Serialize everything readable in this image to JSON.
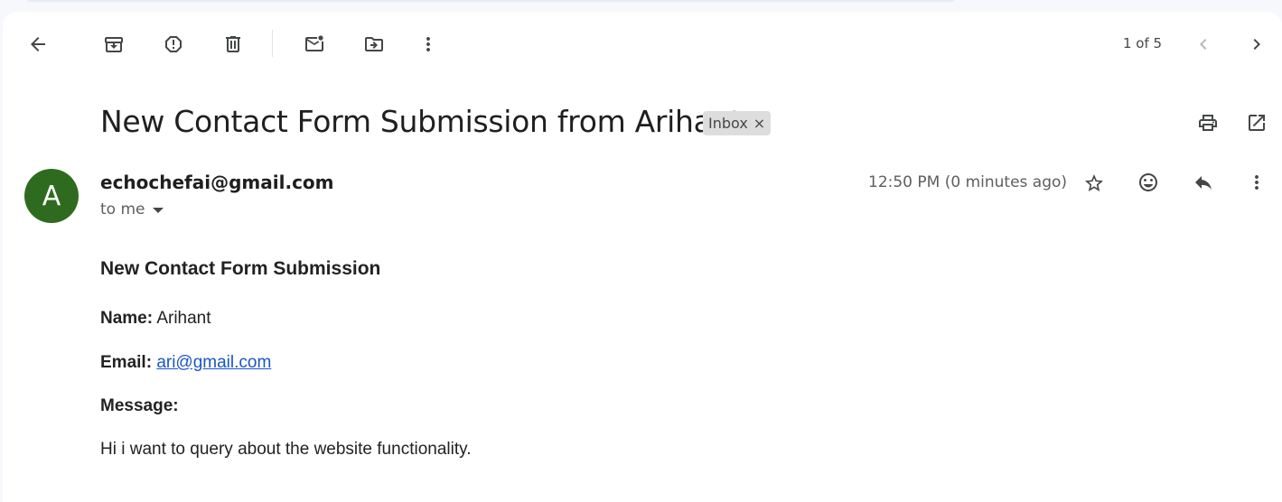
{
  "toolbar": {
    "icons": [
      "back-arrow-icon",
      "archive-icon",
      "report-spam-icon",
      "delete-icon",
      "mark-unread-icon",
      "move-to-icon",
      "more-vert-icon"
    ],
    "pager_text": "1 of 5"
  },
  "email": {
    "subject": "New Contact Form Submission from Arihant",
    "label": "Inbox",
    "label_remove": "×",
    "avatar_letter": "A",
    "avatar_color": "#2e6b1f",
    "sender": "echochefai@gmail.com",
    "recipient_text": "to me",
    "timestamp": "12:50 PM (0 minutes ago)"
  },
  "message": {
    "heading": "New Contact Form Submission",
    "name_label": "Name:",
    "name_value": "Arihant",
    "email_label": "Email:",
    "email_value": "ari@gmail.com",
    "message_label": "Message:",
    "message_text": "Hi i want to query about the website functionality."
  },
  "colors": {
    "accent_link": "#1a55c7",
    "background": "#f6f8fc"
  }
}
